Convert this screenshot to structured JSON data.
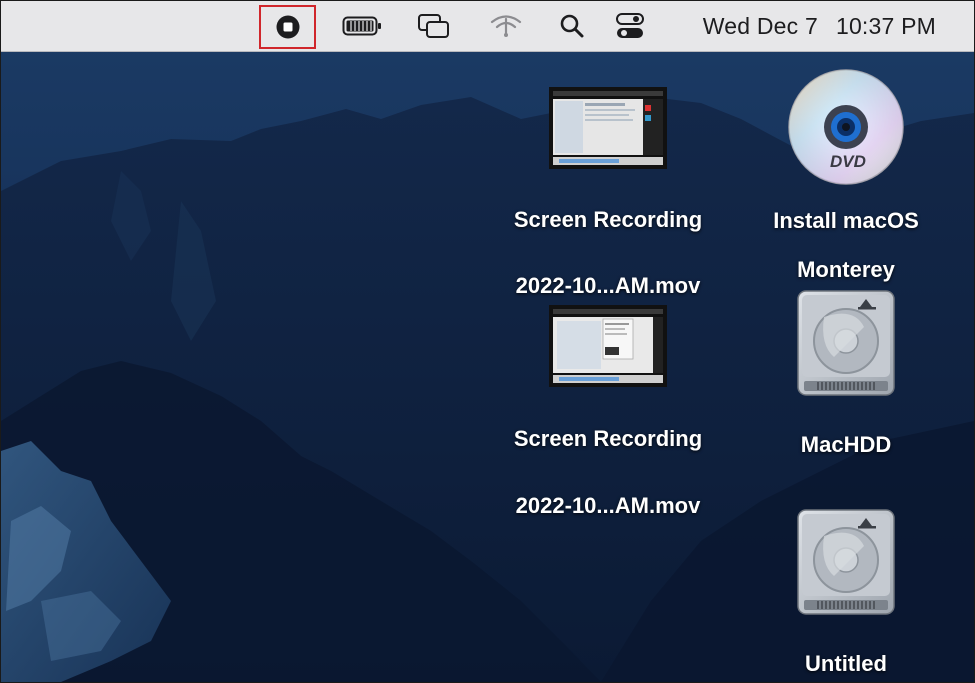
{
  "menubar": {
    "status_items": [
      {
        "icon": "screen-recording-stop-icon",
        "highlighted": true,
        "highlight_color": "#d0262b"
      },
      {
        "icon": "battery-icon"
      },
      {
        "icon": "screen-mirroring-icon"
      },
      {
        "icon": "wifi-icon"
      },
      {
        "icon": "spotlight-search-icon"
      },
      {
        "icon": "control-center-icon"
      }
    ],
    "date": "Wed Dec 7",
    "time": "10:37 PM"
  },
  "desktop": {
    "items": [
      {
        "id": "screen-recording-1",
        "icon": "video-thumbnail-icon",
        "label_line1": "Screen Recording",
        "label_line2": "2022-10...AM.mov"
      },
      {
        "id": "screen-recording-2",
        "icon": "video-thumbnail-icon",
        "label_line1": "Screen Recording",
        "label_line2": "2022-10...AM.mov"
      },
      {
        "id": "install-macos",
        "icon": "dvd-disc-icon",
        "label_line1": "Install macOS",
        "label_line2": "Monterey",
        "dvd_text": "DVD"
      },
      {
        "id": "machdd",
        "icon": "hard-drive-icon",
        "label_line1": "MacHDD"
      },
      {
        "id": "untitled",
        "icon": "hard-drive-icon",
        "label_line1": "Untitled"
      }
    ]
  },
  "colors": {
    "menubar_bg": "#e7e7e9",
    "wallpaper_sky": "#17345c",
    "wallpaper_mountain": "#0f1e3a",
    "label_text": "#ffffff"
  }
}
